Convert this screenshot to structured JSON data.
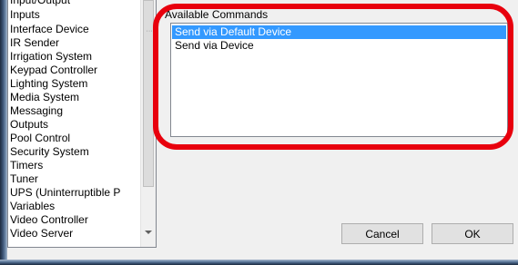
{
  "categories": {
    "items": [
      "Input/Output",
      "Inputs",
      "Interface Device",
      "IR Sender",
      "Irrigation System",
      "Keypad Controller",
      "Lighting System",
      "Media System",
      "Messaging",
      "Outputs",
      "Pool Control",
      "Security System",
      "Timers",
      "Tuner",
      "UPS (Uninterruptible P",
      "Variables",
      "Video Controller",
      "Video Server"
    ]
  },
  "commands": {
    "label": "Available Commands",
    "items": [
      {
        "label": "Send via Default Device",
        "selected": true
      },
      {
        "label": "Send via Device",
        "selected": false
      }
    ]
  },
  "buttons": {
    "cancel_label": "Cancel",
    "ok_label": "OK"
  },
  "colors": {
    "selection": "#3399ff",
    "highlight_ring": "#e8000d"
  }
}
